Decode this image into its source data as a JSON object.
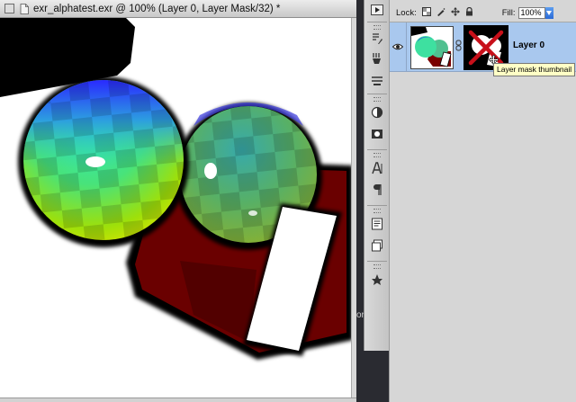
{
  "document": {
    "title": "exr_alphatest.exr @ 100% (Layer 0, Layer Mask/32) *"
  },
  "layers_panel": {
    "lock_label": "Lock:",
    "fill_label": "Fill:",
    "fill_value": "100%",
    "layer": {
      "name": "Layer 0",
      "thumbnail_icon": "layer-thumbnail",
      "mask_icon": "mask-thumbnail-disabled"
    },
    "tooltip": "Layer mask thumbnail"
  },
  "strip": {
    "text": "or"
  },
  "colors": {
    "accent": "#a9c8ee",
    "tooltip_bg": "#ffffc6",
    "mask_x": "#c8101a"
  }
}
